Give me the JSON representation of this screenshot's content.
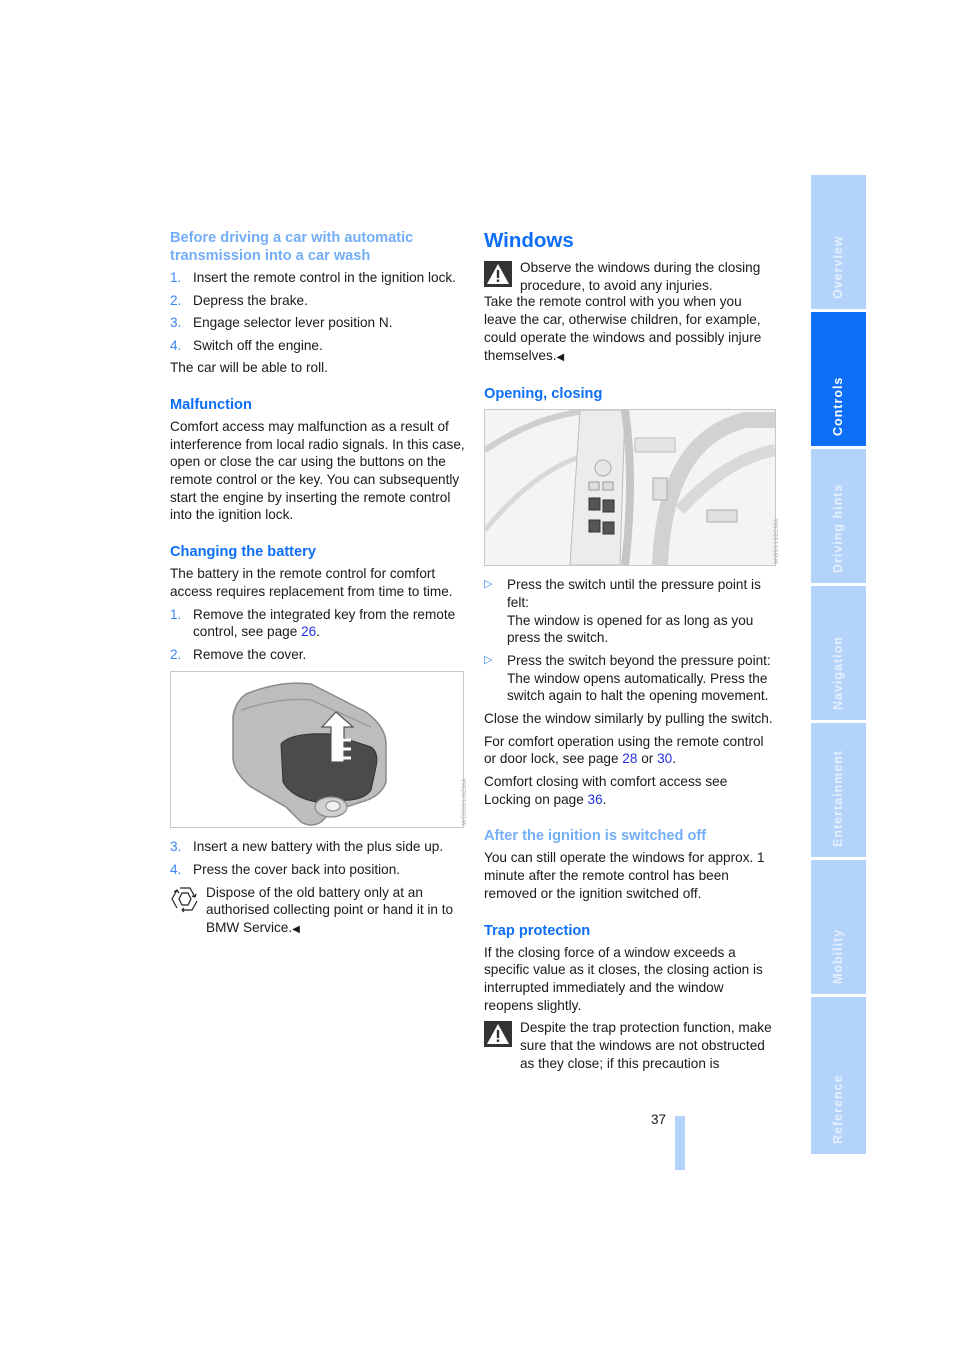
{
  "left_column": {
    "section1": {
      "heading": "Before driving a car with automatic transmission into a car wash",
      "steps": [
        {
          "num": "1.",
          "text": "Insert the remote control in the ignition lock."
        },
        {
          "num": "2.",
          "text": "Depress the brake."
        },
        {
          "num": "3.",
          "text": "Engage selector lever position N."
        },
        {
          "num": "4.",
          "text": "Switch off the engine."
        }
      ],
      "note": "The car will be able to roll."
    },
    "malfunction": {
      "heading": "Malfunction",
      "body": "Comfort access may malfunction as a result of interference from local radio signals. In this case, open or close the car using the buttons on the remote control or the key. You can subsequently start the engine by inserting the remote control into the ignition lock."
    },
    "battery": {
      "heading": "Changing the battery",
      "intro": "The battery in the remote control for comfort access requires replacement from time to time.",
      "step1_num": "1.",
      "step1_text": "Remove the integrated key from the remote control, see page ",
      "step1_link": "26",
      "step1_end": ".",
      "step2_num": "2.",
      "step2_text": "Remove the cover.",
      "figure_code": "WC0001I0CMA",
      "step3_num": "3.",
      "step3_text": "Insert a new battery with the plus side up.",
      "step4_num": "4.",
      "step4_text": "Press the cover back into position.",
      "recycle_note": "Dispose of the old battery only at an authorised collecting point or hand it in to BMW Service.",
      "end_mark": "◀"
    }
  },
  "right_column": {
    "title": "Windows",
    "warning1": "Observe the windows during the closing procedure, to avoid any injuries.",
    "warning1_cont": "Take the remote control with you when you leave the car, otherwise children, for example, could operate the windows and possibly injure themselves.",
    "end_mark": "◀",
    "opening": {
      "heading": "Opening, closing",
      "figure_code": "MW00180CMA",
      "bullets": [
        {
          "lead": "Press the switch until the pressure point is felt:",
          "detail": "The window is opened for as long as you press the switch."
        },
        {
          "lead": "Press the switch beyond the pressure point:",
          "detail": "The window opens automatically. Press the switch again to halt the opening movement."
        }
      ],
      "close_text": "Close the window similarly by pulling the switch.",
      "comfort_text": "For comfort operation using the remote control or door lock, see page ",
      "comfort_link1": "28",
      "comfort_or": " or ",
      "comfort_link2": "30",
      "comfort_end": ".",
      "comfort_closing_text": "Comfort closing with comfort access see Locking on page ",
      "comfort_closing_link": "36",
      "comfort_closing_end": "."
    },
    "after_ignition": {
      "heading": "After the ignition is switched off",
      "body": "You can still operate the windows for approx. 1 minute after the remote control has been removed or the ignition switched off."
    },
    "trap": {
      "heading": "Trap protection",
      "body": "If the closing force of a window exceeds a specific value as it closes, the closing action is interrupted immediately and the window reopens slightly.",
      "warning": "Despite the trap protection function, make sure that the windows are not obstructed as they close; if this precaution is"
    }
  },
  "page_number": "37",
  "side_tabs": [
    {
      "label": "Overview",
      "active": false
    },
    {
      "label": "Controls",
      "active": true
    },
    {
      "label": "Driving hints",
      "active": false
    },
    {
      "label": "Navigation",
      "active": false
    },
    {
      "label": "Entertainment",
      "active": false
    },
    {
      "label": "Mobility",
      "active": false
    },
    {
      "label": "Reference",
      "active": false
    }
  ],
  "colors": {
    "accent": "#0d6ef7",
    "tab_inactive": "#b3d3fb",
    "link": "#2233dd"
  }
}
